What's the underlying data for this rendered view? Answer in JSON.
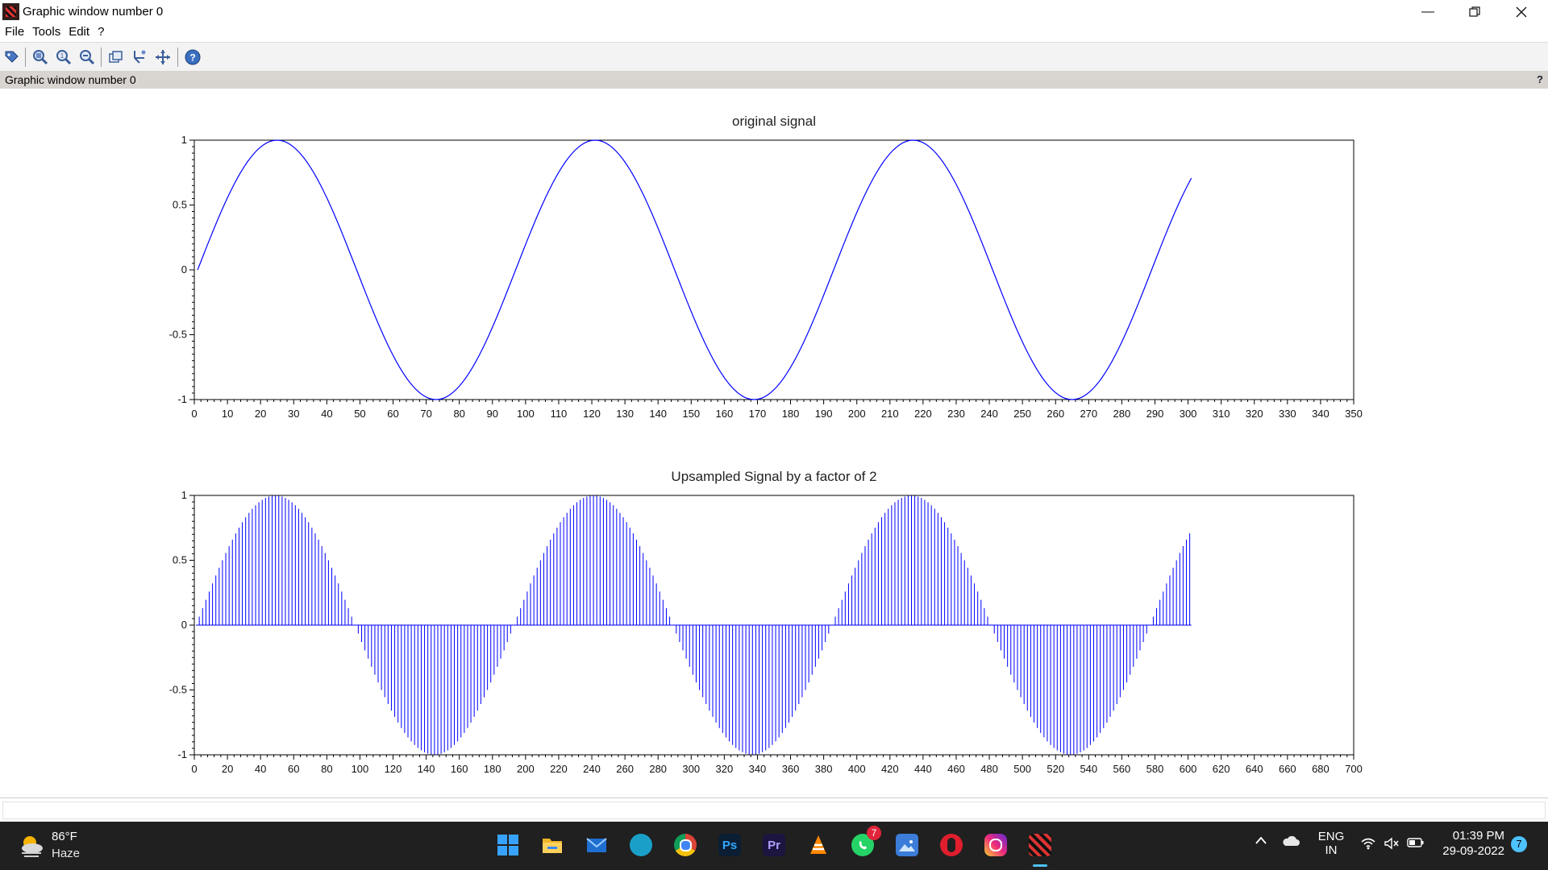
{
  "window": {
    "title": "Graphic window number 0",
    "minimize_icon": "minimize-icon",
    "maximize_icon": "restore-icon",
    "close_icon": "close-icon"
  },
  "menu": [
    "File",
    "Tools",
    "Edit",
    "?"
  ],
  "toolbar": {
    "icons": [
      "datatip-icon",
      "zoom-in-icon",
      "zoom-reset-icon",
      "zoom-out-icon",
      "rotate-icon",
      "rotate-3d-icon",
      "pan-icon",
      "help-icon"
    ]
  },
  "infobar": {
    "text": "Graphic window number 0",
    "help": "?"
  },
  "chart_data": [
    {
      "type": "line",
      "title": "original signal",
      "xlabel": "",
      "ylabel": "",
      "xlim": [
        0,
        350
      ],
      "ylim": [
        -1,
        1
      ],
      "xticks": [
        0,
        10,
        20,
        30,
        40,
        50,
        60,
        70,
        80,
        90,
        100,
        110,
        120,
        130,
        140,
        150,
        160,
        170,
        180,
        190,
        200,
        210,
        220,
        230,
        240,
        250,
        260,
        270,
        280,
        290,
        300,
        310,
        320,
        330,
        340,
        350
      ],
      "yticks": [
        -1,
        -0.5,
        0,
        0.5,
        1
      ],
      "ytick_labels": [
        "-1",
        "-0.5",
        "0",
        "0.5",
        "1"
      ],
      "series": [
        {
          "x_range": [
            1,
            301
          ],
          "y": "sin(2*pi*(x-1)/96)"
        }
      ],
      "color": "#0000ff",
      "grid": false
    },
    {
      "type": "stem",
      "title": "Upsampled Signal by a factor of 2",
      "xlabel": "",
      "ylabel": "",
      "xlim": [
        0,
        700
      ],
      "ylim": [
        -1,
        1
      ],
      "xticks": [
        0,
        20,
        40,
        60,
        80,
        100,
        120,
        140,
        160,
        180,
        200,
        220,
        240,
        260,
        280,
        300,
        320,
        340,
        360,
        380,
        400,
        420,
        440,
        460,
        480,
        500,
        520,
        540,
        560,
        580,
        600,
        620,
        640,
        660,
        680,
        700
      ],
      "yticks": [
        -1,
        -0.5,
        0,
        0.5,
        1
      ],
      "ytick_labels": [
        "-1",
        "-0.5",
        "0",
        "0.5",
        "1"
      ],
      "upsampling_factor": 2,
      "series": [
        {
          "x_range": [
            1,
            602
          ],
          "y": "sin(2*pi*((x-1)/2)/96) at odd x, 0 at even x"
        }
      ],
      "color": "#0000ff",
      "grid": false
    }
  ],
  "taskbar": {
    "weather_temp": "86°F",
    "weather_desc": "Haze",
    "apps": [
      {
        "name": "start-button",
        "icon": "windows-icon",
        "color": "#1e90ff"
      },
      {
        "name": "file-explorer",
        "icon": "folder-icon",
        "color": "#f0b429"
      },
      {
        "name": "mail",
        "icon": "mail-icon",
        "color": "#1f6fd1"
      },
      {
        "name": "edge",
        "icon": "edge-icon",
        "color": "#1aa0c8"
      },
      {
        "name": "chrome",
        "icon": "chrome-icon",
        "color": "#e0a800"
      },
      {
        "name": "photoshop",
        "icon": "photoshop-icon",
        "label": "Ps",
        "color": "#0b1e33"
      },
      {
        "name": "premiere",
        "icon": "premiere-icon",
        "label": "Pr",
        "color": "#1b1540"
      },
      {
        "name": "vlc",
        "icon": "vlc-icon",
        "color": "#ff8800"
      },
      {
        "name": "whatsapp",
        "icon": "whatsapp-icon",
        "badge": "7",
        "color": "#25d366"
      },
      {
        "name": "photos",
        "icon": "photos-icon",
        "color": "#3b7dd8"
      },
      {
        "name": "opera",
        "icon": "opera-icon",
        "color": "#e01e2e"
      },
      {
        "name": "instagram",
        "icon": "instagram-icon",
        "color": "#d6307a"
      },
      {
        "name": "scilab",
        "icon": "scilab-icon",
        "color": "#333333",
        "active": true
      }
    ],
    "tray": {
      "lang_top": "ENG",
      "lang_bottom": "IN",
      "time": "01:39 PM",
      "date": "29-09-2022",
      "notifications": "7",
      "icons": [
        "chevron-up-icon",
        "cloud-icon",
        "wifi-icon",
        "speaker-muted-icon",
        "battery-icon"
      ]
    }
  }
}
